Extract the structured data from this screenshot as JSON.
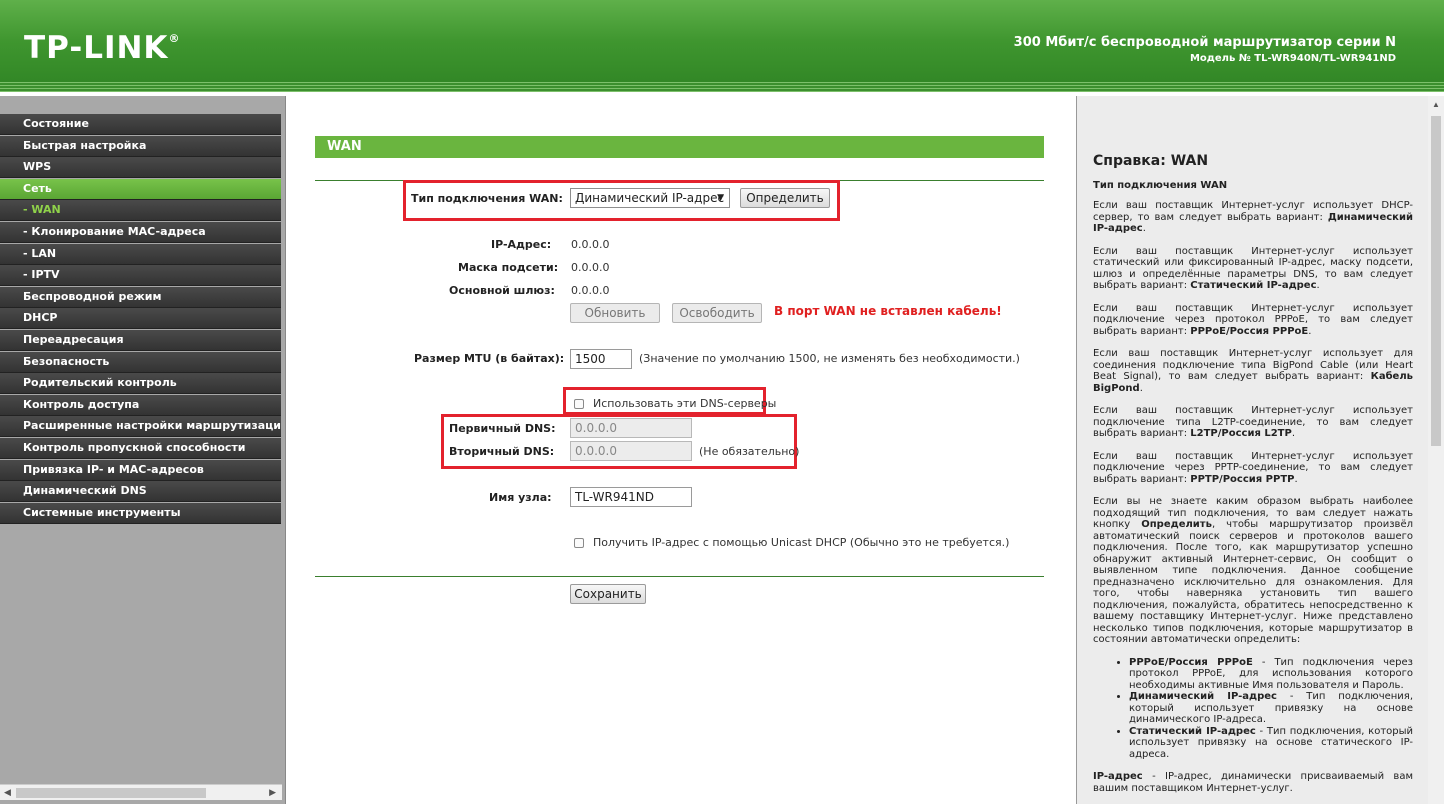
{
  "header": {
    "logo": "TP-LINK",
    "logo_mark": "®",
    "model_title": "300 Мбит/с беспроводной маршрутизатор серии N",
    "model_subtitle": "Модель № TL-WR940N/TL-WR941ND"
  },
  "menu": {
    "items": [
      {
        "label": "Состояние"
      },
      {
        "label": "Быстрая настройка"
      },
      {
        "label": "WPS"
      },
      {
        "label": "Сеть"
      },
      {
        "label": "- WAN"
      },
      {
        "label": "- Клонирование MAC-адреса"
      },
      {
        "label": "- LAN"
      },
      {
        "label": "- IPTV"
      },
      {
        "label": "Беспроводной режим"
      },
      {
        "label": "DHCP"
      },
      {
        "label": "Переадресация"
      },
      {
        "label": "Безопасность"
      },
      {
        "label": "Родительский контроль"
      },
      {
        "label": "Контроль доступа"
      },
      {
        "label": "Расширенные настройки маршрутизации"
      },
      {
        "label": "Контроль пропускной способности"
      },
      {
        "label": "Привязка IP- и MAC-адресов"
      },
      {
        "label": "Динамический DNS"
      },
      {
        "label": "Системные инструменты"
      }
    ]
  },
  "main": {
    "section_title": "WAN",
    "wan_type_label": "Тип подключения WAN:",
    "wan_type_value": "Динамический IP-адрес",
    "detect_button": "Определить",
    "ip_label": "IP-Адрес:",
    "ip_value": "0.0.0.0",
    "mask_label": "Маска подсети:",
    "mask_value": "0.0.0.0",
    "gateway_label": "Основной шлюз:",
    "gateway_value": "0.0.0.0",
    "renew_button": "Обновить",
    "release_button": "Освободить",
    "cable_warning": "В порт WAN не вставлен кабель!",
    "mtu_label": "Размер MTU (в байтах):",
    "mtu_value": "1500",
    "mtu_hint": "(Значение по умолчанию 1500, не изменять без необходимости.)",
    "use_dns_label": "Использовать эти DNS-серверы",
    "primary_dns_label": "Первичный DNS:",
    "primary_dns_value": "0.0.0.0",
    "secondary_dns_label": "Вторичный DNS:",
    "secondary_dns_value": "0.0.0.0",
    "optional_hint": "(Не обязательно)",
    "hostname_label": "Имя узла:",
    "hostname_value": "TL-WR941ND",
    "unicast_label": "Получить IP-адрес с помощью Unicast DHCP (Обычно это не требуется.)",
    "save_button": "Сохранить"
  },
  "help": {
    "title": "Справка: WAN",
    "subtitle": "Тип подключения WAN",
    "p1a": "Если ваш поставщик Интернет-услуг использует DHCP-сервер, то вам следует выбрать вариант: ",
    "p1b": "Динамический IP-адрес",
    "p2a": "Если ваш поставщик Интернет-услуг использует статический или фиксированный IP-адрес, маску подсети, шлюз и определённые параметры DNS, то вам следует выбрать вариант: ",
    "p2b": "Статический IP-адрес",
    "p3a": "Если ваш поставщик Интернет-услуг использует подключение через протокол PPPoE, то вам следует выбрать вариант: ",
    "p3b": "PPPoE/Россия PPPoE",
    "p4a": "Если ваш поставщик Интернет-услуг использует для соединения подключение типа BigPond Cable (или Heart Beat Signal), то вам следует выбрать вариант: ",
    "p4b": "Кабель BigPond",
    "p5a": "Если ваш поставщик Интернет-услуг использует подключение типа L2TP-соединение, то вам следует выбрать вариант: ",
    "p5b": "L2TP/Россия L2TP",
    "p6a": "Если ваш поставщик Интернет-услуг использует подключение через PPTP-соединение, то вам следует выбрать вариант: ",
    "p6b": "PPTP/Россия PPTP",
    "p7a": "Если вы не знаете каким образом выбрать наиболее подходящий тип подключения, то вам следует нажать кнопку ",
    "p7b": "Определить",
    "p7c": ", чтобы маршрутизатор произвёл автоматический поиск серверов и протоколов вашего подключения. После того, как маршрутизатор успешно обнаружит активный Интернет-сервис, Он сообщит о выявленном типе подключения. Данное сообщение предназначено исключительно для ознакомления. Для того, чтобы наверняка установить тип вашего подключения, пожалуйста, обратитесь непосредственно к вашему поставщику Интернет-услуг. Ниже представлено несколько типов подключения, которые маршрутизатор в состоянии автоматически определить:",
    "li1a": "PPPoE/Россия PPPoE",
    "li1b": " - Тип подключения через протокол PPPoE, для использования которого необходимы активные Имя пользователя и Пароль.",
    "li2a": "Динамический IP-адрес",
    "li2b": " - Тип подключения, который использует привязку на основе динамического IP-адреса.",
    "li3a": "Статический IP-адрес",
    "li3b": " - Тип подключения, который использует привязку на основе статического IP-адреса.",
    "p8a": "IP-адрес",
    "p8b": " - IP-адрес, динамически присваиваемый вам вашим поставщиком Интернет-услуг."
  }
}
